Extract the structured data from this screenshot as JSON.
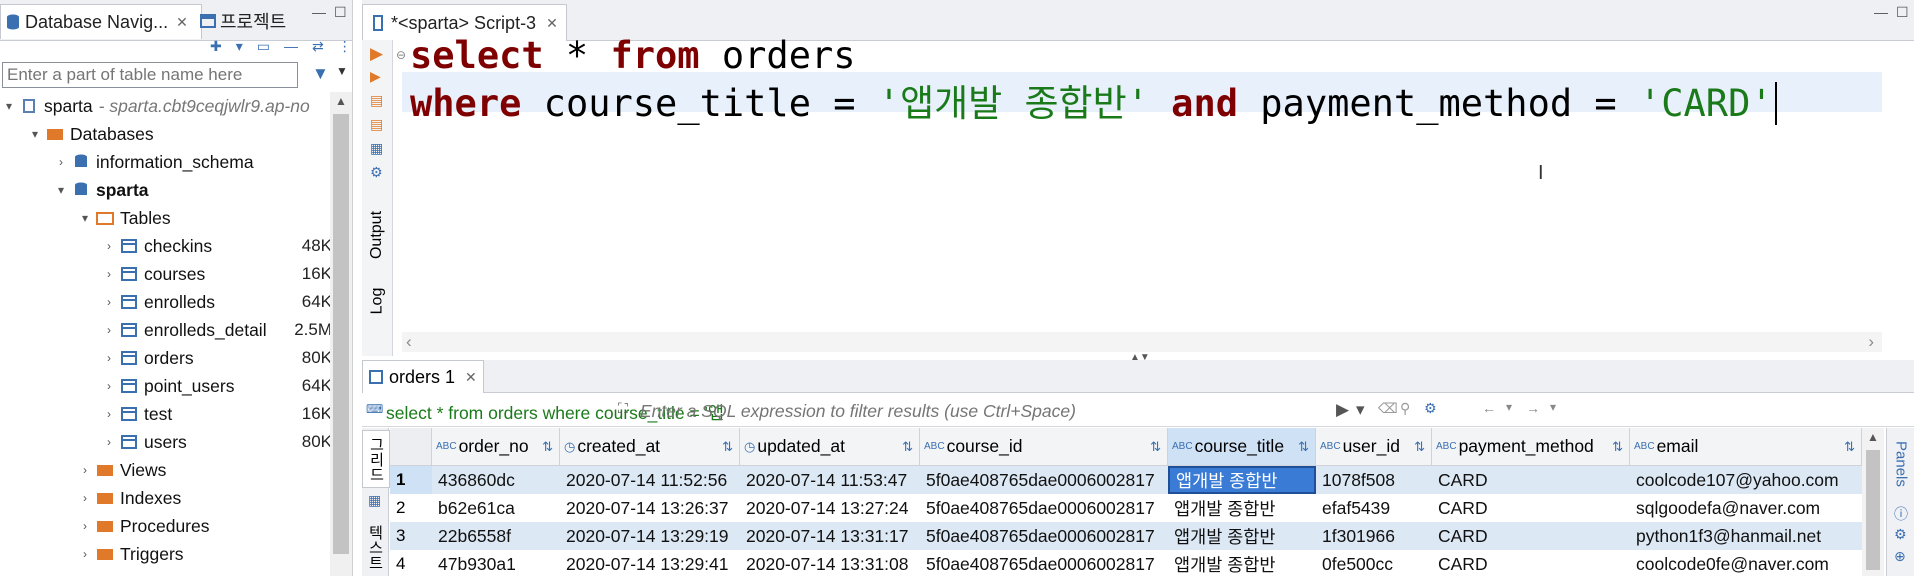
{
  "left_panel": {
    "tabs": [
      {
        "label": "Database Navig..."
      },
      {
        "label": "프로젝트"
      }
    ],
    "search_placeholder": "Enter a part of table name here",
    "tree": {
      "connection": "sparta",
      "connection_detail": "- sparta.cbt9ceqjwlr9.ap-no",
      "databases_label": "Databases",
      "schemas": [
        "information_schema",
        "sparta"
      ],
      "tables_label": "Tables",
      "tables": [
        {
          "name": "checkins",
          "size": "48K"
        },
        {
          "name": "courses",
          "size": "16K"
        },
        {
          "name": "enrolleds",
          "size": "64K"
        },
        {
          "name": "enrolleds_detail",
          "size": "2.5M"
        },
        {
          "name": "orders",
          "size": "80K"
        },
        {
          "name": "point_users",
          "size": "64K"
        },
        {
          "name": "test",
          "size": "16K"
        },
        {
          "name": "users",
          "size": "80K"
        }
      ],
      "folders": [
        "Views",
        "Indexes",
        "Procedures",
        "Triggers"
      ]
    }
  },
  "editor": {
    "tab_label": "*<sparta> Script-3",
    "side_tabs": [
      "Output",
      "Log"
    ],
    "sql_line1": {
      "kw1": "select",
      "mid": " * ",
      "kw2": "from",
      "rest": " orders"
    },
    "sql_line2": {
      "kw1": "where",
      "a": " course_title = ",
      "s1": "'앱개발 종합반'",
      "kw2": " and",
      "b": " payment_method = ",
      "s2": "'CARD'"
    }
  },
  "results": {
    "tab_label": "orders 1",
    "filter_query": "select * from orders where course_title = '앱",
    "filter_placeholder": "Enter a SQL expression to filter results (use Ctrl+Space)",
    "left_vertical_tabs": [
      "그리드",
      "텍스트"
    ],
    "right_vertical_tab": "Panels",
    "columns": [
      "order_no",
      "created_at",
      "updated_at",
      "course_id",
      "course_title",
      "user_id",
      "payment_method",
      "email"
    ],
    "rows": [
      {
        "n": "1",
        "cells": [
          "436860dc",
          "2020-07-14 11:52:56",
          "2020-07-14 11:53:47",
          "5f0ae408765dae0006002817",
          "앱개발 종합반",
          "1078f508",
          "CARD",
          "coolcode107@yahoo.com"
        ]
      },
      {
        "n": "2",
        "cells": [
          "b62e61ca",
          "2020-07-14 13:26:37",
          "2020-07-14 13:27:24",
          "5f0ae408765dae0006002817",
          "앱개발 종합반",
          "efaf5439",
          "CARD",
          "sqlgoodefa@naver.com"
        ]
      },
      {
        "n": "3",
        "cells": [
          "22b6558f",
          "2020-07-14 13:29:19",
          "2020-07-14 13:31:17",
          "5f0ae408765dae0006002817",
          "앱개발 종합반",
          "1f301966",
          "CARD",
          "python1f3@hanmail.net"
        ]
      },
      {
        "n": "4",
        "cells": [
          "47b930a1",
          "2020-07-14 13:29:41",
          "2020-07-14 13:31:08",
          "5f0ae408765dae0006002817",
          "앱개발 종합반",
          "0fe500cc",
          "CARD",
          "coolcode0fe@naver.com"
        ]
      }
    ],
    "selected_row": 1,
    "selected_column": "course_title"
  },
  "colors": {
    "keyword": "#7f0000",
    "string": "#1a7a1a",
    "selection": "#cfe1f5",
    "highlight_line": "#e8f0fb"
  }
}
